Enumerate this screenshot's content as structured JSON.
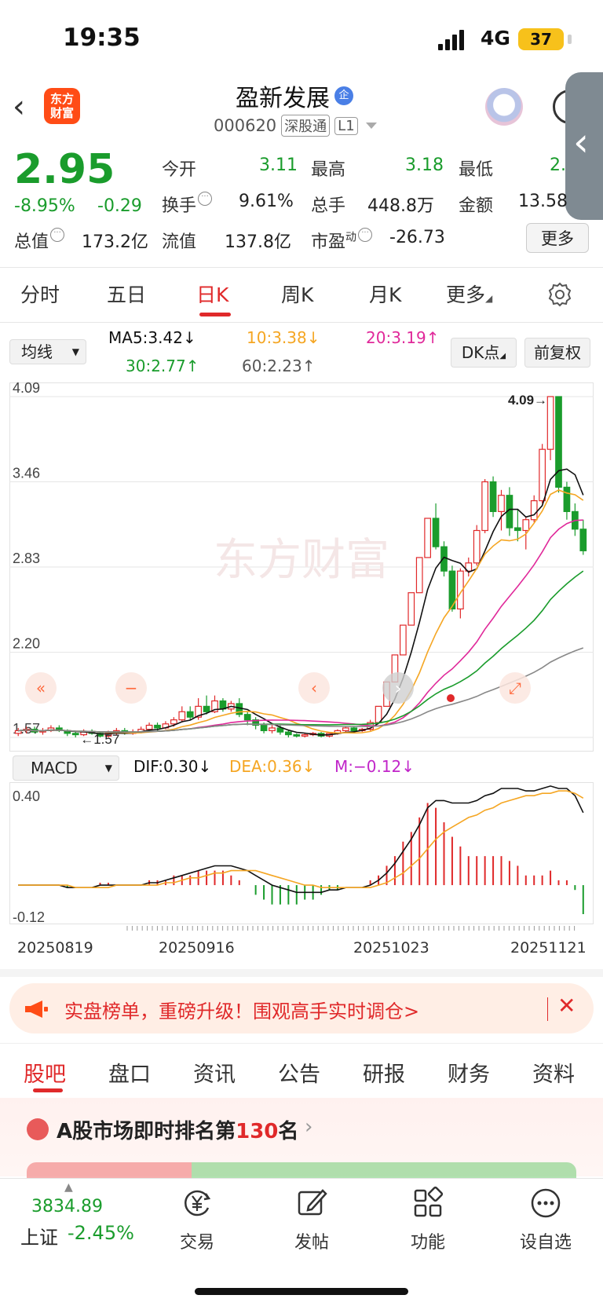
{
  "status_bar": {
    "time": "19:35",
    "network": "4G",
    "battery": "37"
  },
  "header": {
    "logo_line1": "东方",
    "logo_line2": "财富",
    "stock_name": "盈新发展",
    "verified_badge": "企",
    "code": "000620",
    "tag_connect": "深股通",
    "tag_level": "L1"
  },
  "quote": {
    "price": "2.95",
    "change_pct": "-8.95%",
    "change_abs": "-0.29",
    "open_label": "今开",
    "open": "3.11",
    "high_label": "最高",
    "high": "3.18",
    "low_label": "最低",
    "low": "2.",
    "turnover_label": "换手",
    "turnover": "9.61%",
    "volume_label": "总手",
    "volume": "448.8万",
    "amount_label": "金额",
    "amount": "13.58",
    "mcap_label": "总值",
    "mcap": "173.2亿",
    "float_label": "流值",
    "float_cap": "137.8亿",
    "pe_label": "市盈",
    "pe_sup": "动",
    "pe": "-26.73",
    "more_label": "更多"
  },
  "period_tabs": [
    "分时",
    "五日",
    "日K",
    "周K",
    "月K",
    "更多"
  ],
  "active_period": "日K",
  "ma_row": {
    "select_label": "均线",
    "ma5": "MA5:3.42",
    "ma10": "10:3.38",
    "ma20": "20:3.19",
    "ma30": "30:2.77",
    "ma60": "60:2.23",
    "dk_label": "DK点",
    "adjust_label": "前复权"
  },
  "chart_data": [
    {
      "type": "candlestick",
      "title": "",
      "ylim": [
        1.57,
        4.09
      ],
      "y_ticks": [
        "4.09",
        "3.46",
        "2.83",
        "2.20",
        "1.57"
      ],
      "max_marker": "4.09",
      "min_marker": "1.57",
      "watermark": "东方财富",
      "x_dates": [
        "20250819",
        "20250916",
        "20251023",
        "20251121"
      ],
      "candles": [
        [
          1.6,
          1.62,
          1.58,
          1.64
        ],
        [
          1.62,
          1.63,
          1.6,
          1.65
        ],
        [
          1.63,
          1.61,
          1.6,
          1.65
        ],
        [
          1.61,
          1.62,
          1.59,
          1.64
        ],
        [
          1.62,
          1.64,
          1.61,
          1.66
        ],
        [
          1.64,
          1.62,
          1.61,
          1.66
        ],
        [
          1.62,
          1.6,
          1.58,
          1.63
        ],
        [
          1.6,
          1.59,
          1.57,
          1.62
        ],
        [
          1.59,
          1.61,
          1.58,
          1.63
        ],
        [
          1.61,
          1.6,
          1.59,
          1.63
        ],
        [
          1.6,
          1.58,
          1.57,
          1.61
        ],
        [
          1.58,
          1.6,
          1.57,
          1.62
        ],
        [
          1.6,
          1.62,
          1.59,
          1.64
        ],
        [
          1.62,
          1.6,
          1.59,
          1.64
        ],
        [
          1.6,
          1.61,
          1.59,
          1.63
        ],
        [
          1.61,
          1.63,
          1.6,
          1.65
        ],
        [
          1.63,
          1.66,
          1.62,
          1.68
        ],
        [
          1.66,
          1.64,
          1.62,
          1.68
        ],
        [
          1.64,
          1.67,
          1.63,
          1.69
        ],
        [
          1.67,
          1.7,
          1.65,
          1.72
        ],
        [
          1.7,
          1.76,
          1.68,
          1.8
        ],
        [
          1.76,
          1.72,
          1.7,
          1.8
        ],
        [
          1.72,
          1.8,
          1.7,
          1.86
        ],
        [
          1.8,
          1.76,
          1.74,
          1.88
        ],
        [
          1.76,
          1.84,
          1.75,
          1.88
        ],
        [
          1.84,
          1.78,
          1.76,
          1.86
        ],
        [
          1.78,
          1.82,
          1.76,
          1.84
        ],
        [
          1.82,
          1.74,
          1.72,
          1.86
        ],
        [
          1.74,
          1.7,
          1.66,
          1.76
        ],
        [
          1.7,
          1.66,
          1.63,
          1.72
        ],
        [
          1.66,
          1.62,
          1.6,
          1.68
        ],
        [
          1.62,
          1.64,
          1.6,
          1.66
        ],
        [
          1.64,
          1.61,
          1.59,
          1.66
        ],
        [
          1.61,
          1.59,
          1.57,
          1.62
        ],
        [
          1.59,
          1.58,
          1.57,
          1.6
        ],
        [
          1.58,
          1.59,
          1.57,
          1.6
        ],
        [
          1.59,
          1.6,
          1.58,
          1.61
        ],
        [
          1.6,
          1.58,
          1.57,
          1.61
        ],
        [
          1.58,
          1.6,
          1.57,
          1.61
        ],
        [
          1.6,
          1.62,
          1.59,
          1.63
        ],
        [
          1.62,
          1.64,
          1.61,
          1.65
        ],
        [
          1.64,
          1.62,
          1.61,
          1.65
        ],
        [
          1.62,
          1.63,
          1.61,
          1.64
        ],
        [
          1.63,
          1.68,
          1.62,
          1.7
        ],
        [
          1.68,
          1.8,
          1.67,
          1.8
        ],
        [
          1.8,
          1.98,
          1.8,
          1.98
        ],
        [
          1.98,
          2.18,
          1.98,
          2.18
        ],
        [
          2.18,
          2.4,
          2.18,
          2.4
        ],
        [
          2.4,
          2.64,
          2.4,
          2.64
        ],
        [
          2.64,
          2.9,
          2.64,
          2.9
        ],
        [
          2.9,
          3.19,
          2.9,
          3.19
        ],
        [
          3.19,
          2.98,
          2.96,
          3.3
        ],
        [
          2.98,
          2.8,
          2.76,
          3.02
        ],
        [
          2.8,
          2.52,
          2.5,
          2.84
        ],
        [
          2.52,
          2.8,
          2.45,
          2.82
        ],
        [
          2.8,
          2.86,
          2.76,
          2.9
        ],
        [
          2.86,
          3.1,
          2.84,
          3.14
        ],
        [
          3.1,
          3.46,
          3.08,
          3.48
        ],
        [
          3.46,
          3.24,
          3.2,
          3.5
        ],
        [
          3.24,
          3.36,
          3.1,
          3.4
        ],
        [
          3.36,
          3.12,
          3.06,
          3.42
        ],
        [
          3.12,
          3.1,
          3.02,
          3.26
        ],
        [
          3.1,
          3.18,
          2.96,
          3.2
        ],
        [
          3.18,
          3.32,
          3.16,
          3.36
        ],
        [
          3.32,
          3.7,
          3.3,
          3.74
        ],
        [
          3.7,
          4.09,
          3.62,
          4.09
        ],
        [
          4.09,
          3.42,
          3.38,
          4.09
        ],
        [
          3.42,
          3.24,
          3.18,
          3.46
        ],
        [
          3.24,
          3.11,
          3.06,
          3.3
        ],
        [
          3.11,
          2.95,
          2.92,
          3.18
        ]
      ],
      "ma_series": [
        {
          "name": "MA5",
          "color": "#111111",
          "last": "3.42"
        },
        {
          "name": "10",
          "color": "#f5a623",
          "last": "3.38"
        },
        {
          "name": "20",
          "color": "#e0299a",
          "last": "3.19"
        },
        {
          "name": "30",
          "color": "#1a9c2c",
          "last": "2.77"
        },
        {
          "name": "60",
          "color": "#888888",
          "last": "2.23"
        }
      ]
    },
    {
      "type": "bar",
      "title": "MACD",
      "ylim": [
        -0.12,
        0.4
      ],
      "y_ticks": [
        "0.40",
        "-0.12"
      ],
      "DIF": "0.30",
      "DEA": "0.36",
      "M": "-0.12",
      "dif_series": [
        0.0,
        0.0,
        0.0,
        0.0,
        0.0,
        0.0,
        -0.01,
        -0.01,
        -0.01,
        -0.01,
        0.0,
        0.0,
        0.0,
        0.0,
        0.0,
        0.0,
        0.01,
        0.01,
        0.02,
        0.03,
        0.04,
        0.05,
        0.06,
        0.07,
        0.08,
        0.08,
        0.08,
        0.07,
        0.06,
        0.04,
        0.02,
        0.0,
        -0.01,
        -0.02,
        -0.03,
        -0.03,
        -0.03,
        -0.03,
        -0.02,
        -0.02,
        -0.01,
        -0.01,
        -0.01,
        0.0,
        0.02,
        0.05,
        0.09,
        0.14,
        0.19,
        0.25,
        0.32,
        0.35,
        0.35,
        0.34,
        0.34,
        0.34,
        0.35,
        0.37,
        0.38,
        0.4,
        0.4,
        0.4,
        0.39,
        0.39,
        0.4,
        0.41,
        0.4,
        0.4,
        0.37,
        0.3
      ],
      "dea_series": [
        0.0,
        0.0,
        0.0,
        0.0,
        0.0,
        0.0,
        0.0,
        -0.01,
        -0.01,
        -0.01,
        -0.01,
        -0.01,
        0.0,
        0.0,
        0.0,
        0.0,
        0.0,
        0.0,
        0.01,
        0.01,
        0.02,
        0.03,
        0.03,
        0.04,
        0.05,
        0.05,
        0.06,
        0.06,
        0.06,
        0.06,
        0.05,
        0.04,
        0.03,
        0.02,
        0.01,
        0.0,
        0.0,
        -0.01,
        -0.01,
        -0.01,
        -0.01,
        -0.01,
        -0.01,
        -0.01,
        0.0,
        0.01,
        0.03,
        0.05,
        0.08,
        0.11,
        0.15,
        0.19,
        0.22,
        0.24,
        0.26,
        0.28,
        0.29,
        0.31,
        0.32,
        0.34,
        0.35,
        0.36,
        0.37,
        0.37,
        0.38,
        0.38,
        0.39,
        0.39,
        0.38,
        0.36
      ],
      "hist_series": [
        0.0,
        0.0,
        0.0,
        0.0,
        0.0,
        0.0,
        -0.01,
        0.0,
        0.0,
        0.0,
        0.01,
        0.01,
        0.0,
        0.0,
        0.0,
        0.0,
        0.02,
        0.02,
        0.02,
        0.04,
        0.04,
        0.04,
        0.06,
        0.06,
        0.06,
        0.06,
        0.04,
        0.02,
        0.0,
        -0.04,
        -0.06,
        -0.08,
        -0.08,
        -0.08,
        -0.08,
        -0.06,
        -0.06,
        -0.04,
        -0.02,
        -0.02,
        0.0,
        0.0,
        0.0,
        0.02,
        0.04,
        0.08,
        0.12,
        0.18,
        0.22,
        0.28,
        0.34,
        0.32,
        0.26,
        0.2,
        0.16,
        0.12,
        0.12,
        0.12,
        0.12,
        0.12,
        0.1,
        0.08,
        0.04,
        0.04,
        0.04,
        0.06,
        0.02,
        0.02,
        -0.02,
        -0.12
      ]
    }
  ],
  "macd_row": {
    "select_label": "MACD",
    "dif": "DIF:0.30",
    "dea": "DEA:0.36",
    "m": "M:−0.12"
  },
  "banner": {
    "text": "实盘榜单，重磅升级！围观高手实时调仓>",
    "close": "✕"
  },
  "bottom_tabs": [
    "股吧",
    "盘口",
    "资讯",
    "公告",
    "研报",
    "财务",
    "资料"
  ],
  "rank": {
    "prefix": "A股市场即时排名第",
    "number": "130",
    "suffix": "名"
  },
  "index_summary": {
    "value": "3834.89",
    "name": "上证",
    "pct": "-2.45%"
  },
  "nav": [
    {
      "label": "交易",
      "icon": "yen-exchange-icon"
    },
    {
      "label": "发帖",
      "icon": "edit-icon"
    },
    {
      "label": "功能",
      "icon": "grid-icon"
    },
    {
      "label": "设自选",
      "icon": "more-dots-icon"
    }
  ],
  "colors": {
    "up": "#e0292a",
    "down": "#1a9c2c",
    "accent": "#ff4c16"
  }
}
